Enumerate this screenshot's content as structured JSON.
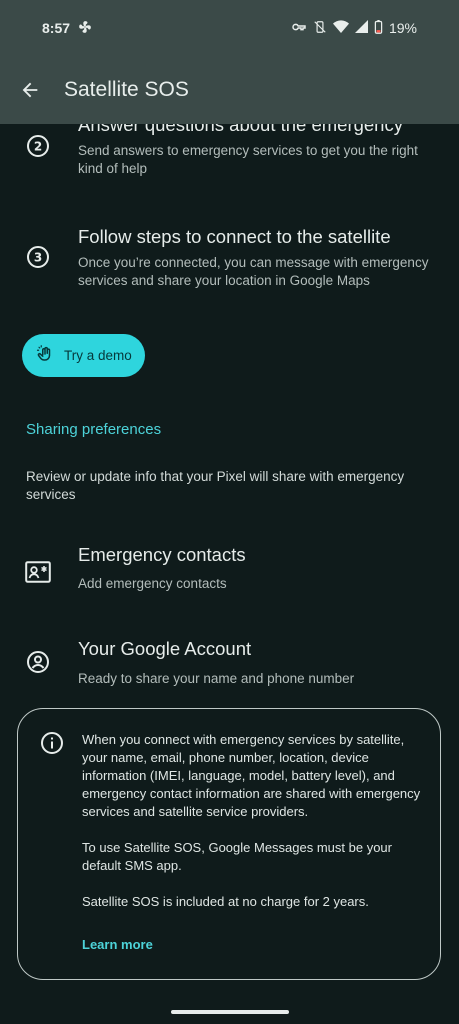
{
  "status_bar": {
    "time": "8:57",
    "battery": "19%"
  },
  "app_bar": {
    "title": "Satellite SOS"
  },
  "steps": [
    {
      "number": "2",
      "title": "Answer questions about the emergency",
      "subtitle": "Send answers to emergency services to get you the right kind of help"
    },
    {
      "number": "3",
      "title": "Follow steps to connect to the satellite",
      "subtitle": "Once you’re connected, you can message with emergency services and share your location in Google Maps"
    }
  ],
  "demo_button": {
    "label": "Try a demo"
  },
  "sharing": {
    "header": "Sharing preferences",
    "description": "Review or update info that your Pixel will share with emergency services",
    "items": [
      {
        "title": "Emergency contacts",
        "subtitle": "Add emergency contacts",
        "icon": "contact-card-icon"
      },
      {
        "title": "Your Google Account",
        "subtitle": "Ready to share your name and phone number",
        "icon": "account-circle-icon"
      }
    ]
  },
  "info_card": {
    "paragraph1": "When you connect with emergency services by satellite, your name, email, phone number, location, device information (IMEI, language, model, battery level), and emergency contact information are shared with emergency services and satellite service providers.",
    "paragraph2": "To use Satellite SOS, Google Messages must be your default SMS app.",
    "paragraph3": "Satellite SOS is included at no charge for 2 years.",
    "link": "Learn more"
  },
  "colors": {
    "background": "#0f1b1b",
    "app_bar": "#3b4a48",
    "accent": "#2ed5dd",
    "link": "#4dd3d9"
  }
}
